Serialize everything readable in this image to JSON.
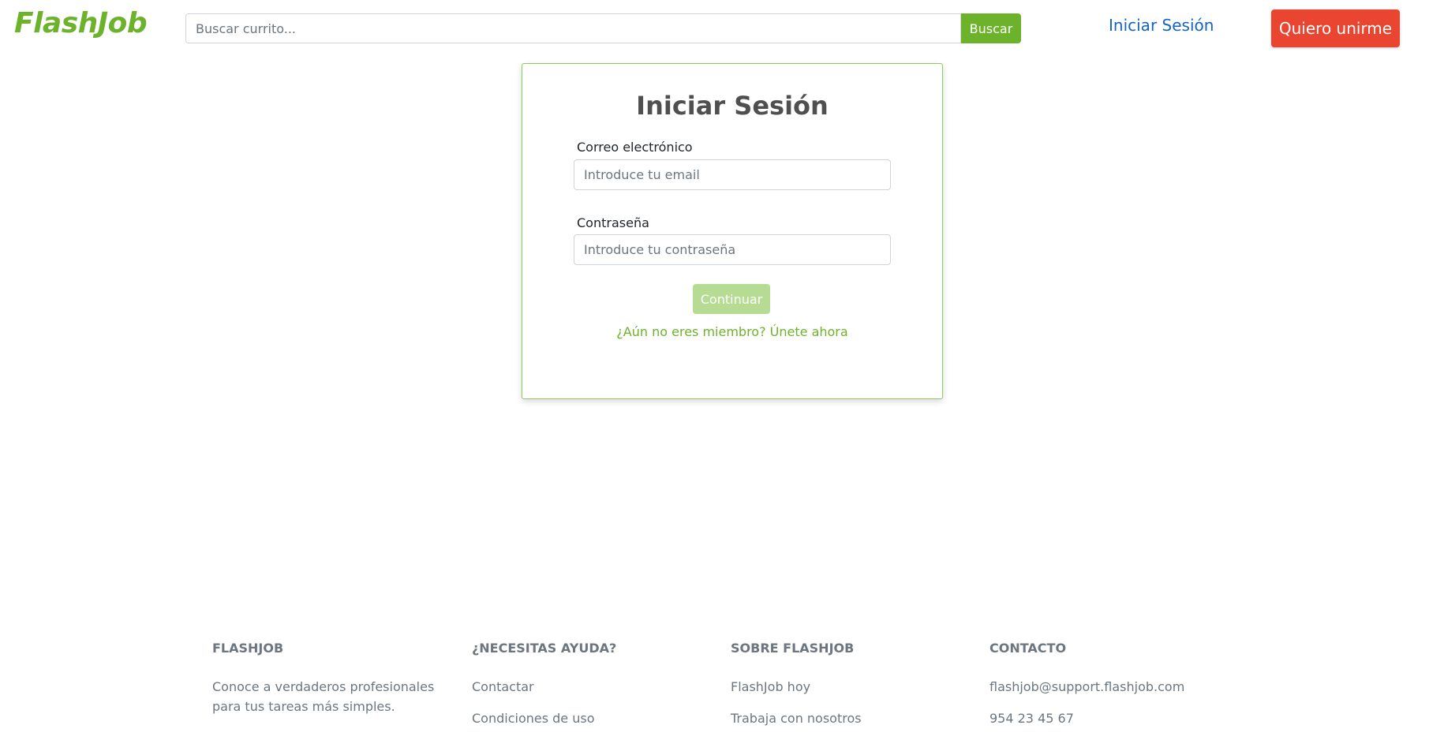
{
  "header": {
    "logo": "FlashJob",
    "search_placeholder": "Buscar currito...",
    "search_button": "Buscar",
    "login_link": "Iniciar Sesión",
    "join_button": "Quiero unirme"
  },
  "login": {
    "title": "Iniciar Sesión",
    "email_label": "Correo electrónico",
    "email_placeholder": "Introduce tu email",
    "password_label": "Contraseña",
    "password_placeholder": "Introduce tu contraseña",
    "continue_button": "Continuar",
    "signup_link": "¿Aún no eres miembro? Únete ahora"
  },
  "footer": {
    "columns": [
      {
        "heading": "FLASHJOB",
        "text": "Conoce a verdaderos profesionales para tus tareas más simples."
      },
      {
        "heading": "¿NECESITAS AYUDA?",
        "links": [
          "Contactar",
          "Condiciones de uso"
        ]
      },
      {
        "heading": "SOBRE FLASHJOB",
        "links": [
          "FlashJob hoy",
          "Trabaja con nosotros"
        ]
      },
      {
        "heading": "CONTACTO",
        "links": [
          "flashjob@support.flashjob.com",
          "954 23 45 67"
        ]
      }
    ]
  },
  "colors": {
    "brand_green": "#6cb32b",
    "login_blue": "#1565c0",
    "join_red": "#e94531",
    "continue_disabled": "#b6dc93"
  }
}
